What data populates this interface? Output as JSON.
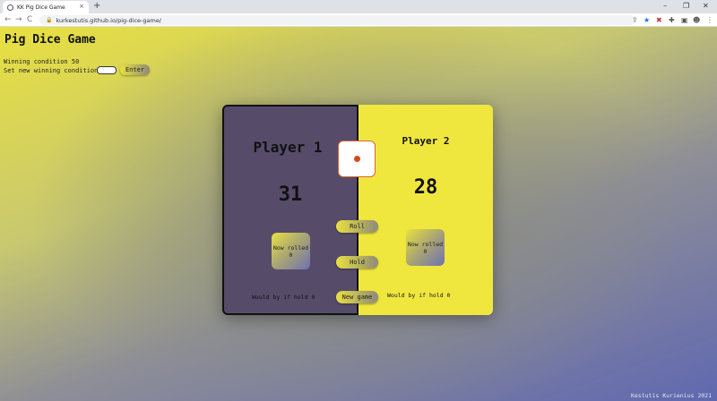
{
  "browser": {
    "tab_title": "KK Pig Dice Game",
    "tab_close": "×",
    "new_tab": "+",
    "url": "kurkestutis.github.io/pig-dice-game/",
    "back": "←",
    "forward": "→",
    "reload": "C",
    "minimize": "–",
    "restore": "❐",
    "close": "✕"
  },
  "page": {
    "title": "Pig Dice Game",
    "winning_condition_text": "Winning condition 50",
    "set_winning_label": "Set new winning condition",
    "winning_input_value": "",
    "enter_label": "Enter",
    "credit": "Kestutis Kurienius 2021"
  },
  "game": {
    "player1": {
      "name": "Player 1",
      "score": "31",
      "now_rolled_label": "Now rolled",
      "now_rolled_value": "0",
      "would_be_if_hold": "Would by if hold  0"
    },
    "player2": {
      "name": "Player 2",
      "score": "28",
      "now_rolled_label": "Now rolled",
      "now_rolled_value": "0",
      "would_be_if_hold": "Would by if hold  0"
    },
    "die_value": 1,
    "roll_label": "Roll",
    "hold_label": "Hold",
    "new_game_label": "New game"
  },
  "colors": {
    "player1_bg": "#564c6a",
    "player2_bg": "#f0e73e",
    "pip": "#d44a1e"
  }
}
